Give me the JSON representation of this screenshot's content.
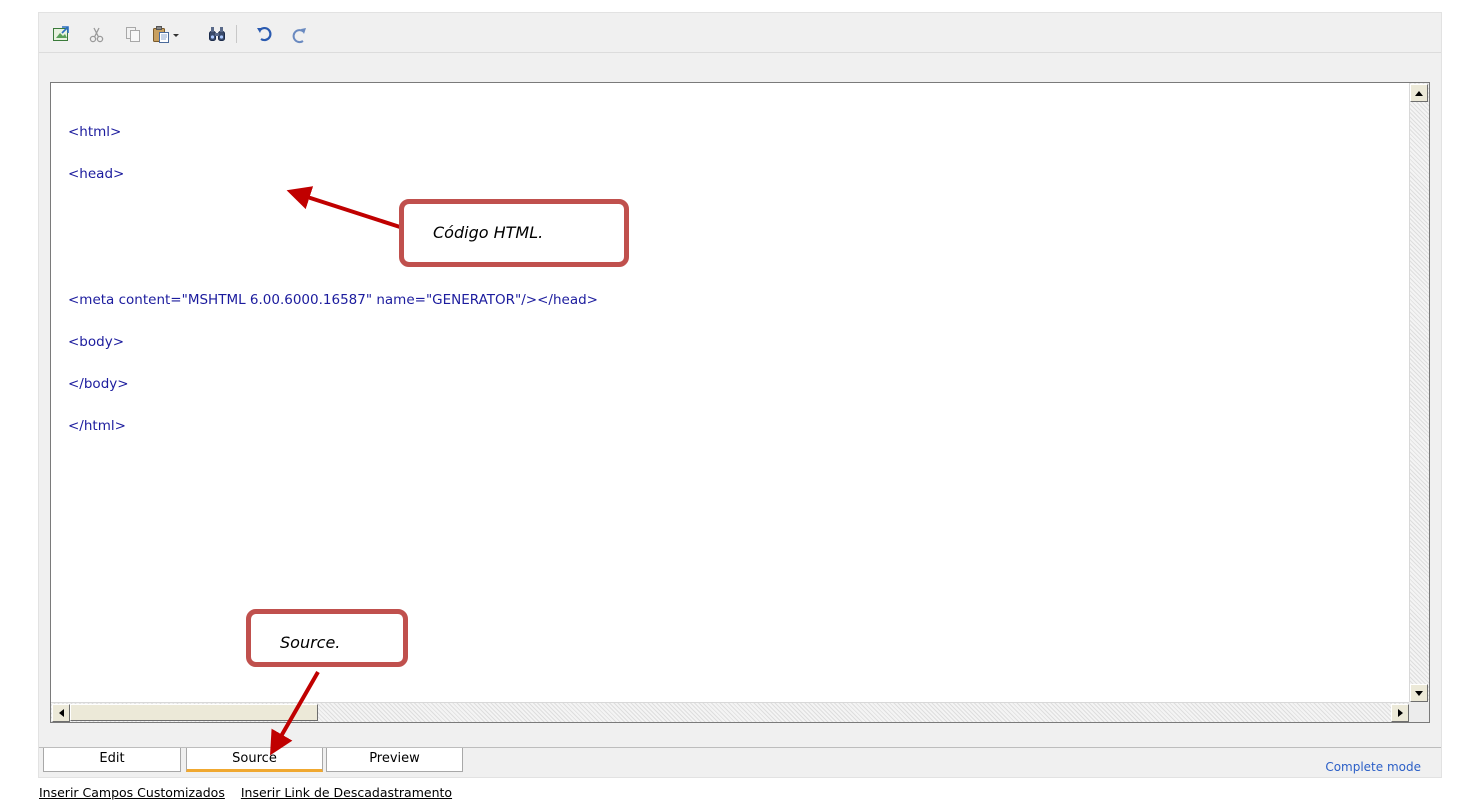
{
  "toolbar": {
    "buttons": [
      {
        "icon": "image-export-icon",
        "label": "Insert"
      },
      {
        "icon": "cut-icon",
        "label": "Cut"
      },
      {
        "icon": "copy-icon",
        "label": "Copy"
      },
      {
        "icon": "paste-icon",
        "label": "Paste"
      },
      {
        "icon": "find-icon",
        "label": "Find"
      },
      {
        "icon": "undo-icon",
        "label": "Undo"
      },
      {
        "icon": "redo-icon",
        "label": "Redo"
      }
    ]
  },
  "source": {
    "lines": [
      "<html>",
      "<head>",
      "",
      "",
      "<meta content=\"MSHTML 6.00.6000.16587\" name=\"GENERATOR\"/></head>",
      "<body>",
      "</body>",
      "</html>"
    ]
  },
  "annotations": {
    "html_code": "Código HTML.",
    "source": "Source.",
    "color": "#c0504d"
  },
  "tabs": {
    "edit": "Edit",
    "source": "Source",
    "preview": "Preview",
    "active": "Source"
  },
  "mode": "Complete mode",
  "links": {
    "custom_fields": "Inserir Campos Customizados",
    "unsubscribe": "Inserir Link de Descadastramento"
  },
  "colors": {
    "code_text": "#1c1c9e",
    "mode_text": "#2b5fc7",
    "active_tab_accent": "#f0a830"
  }
}
